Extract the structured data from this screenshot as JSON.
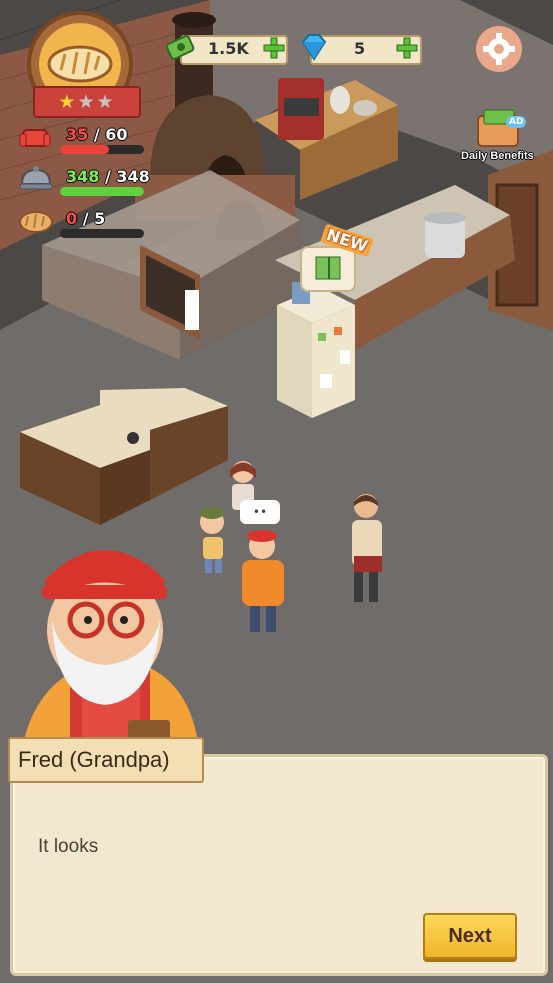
{
  "hud": {
    "cash": "1.5K",
    "gems": "5",
    "stars": {
      "filled": 1,
      "total": 3
    },
    "stats": [
      {
        "icon": "armchair-icon",
        "current": "35",
        "max": "60",
        "current_color": "#ff4a4a",
        "fill": 0.58,
        "bar_color": "#e8443a"
      },
      {
        "icon": "cloche-icon",
        "current": "348",
        "max": "348",
        "current_color": "#7ef04e",
        "fill": 1.0,
        "bar_color": "#5fd13c"
      },
      {
        "icon": "bread-icon",
        "current": "0",
        "max": "5",
        "current_color": "#ff4a4a",
        "fill": 0.0,
        "bar_color": "#e8443a"
      }
    ],
    "separator": " / "
  },
  "daily_benefits": {
    "label": "Daily Benefits",
    "ad_label": "AD"
  },
  "new_badge": "NEW",
  "speech_bubble": "••",
  "dialog": {
    "speaker": "Fred (Grandpa)",
    "text": "It looks",
    "next_label": "Next"
  },
  "colors": {
    "floor": "#6f6b68",
    "wall_brick": "#8b5a45",
    "button_yellow": "#f5c43a"
  }
}
